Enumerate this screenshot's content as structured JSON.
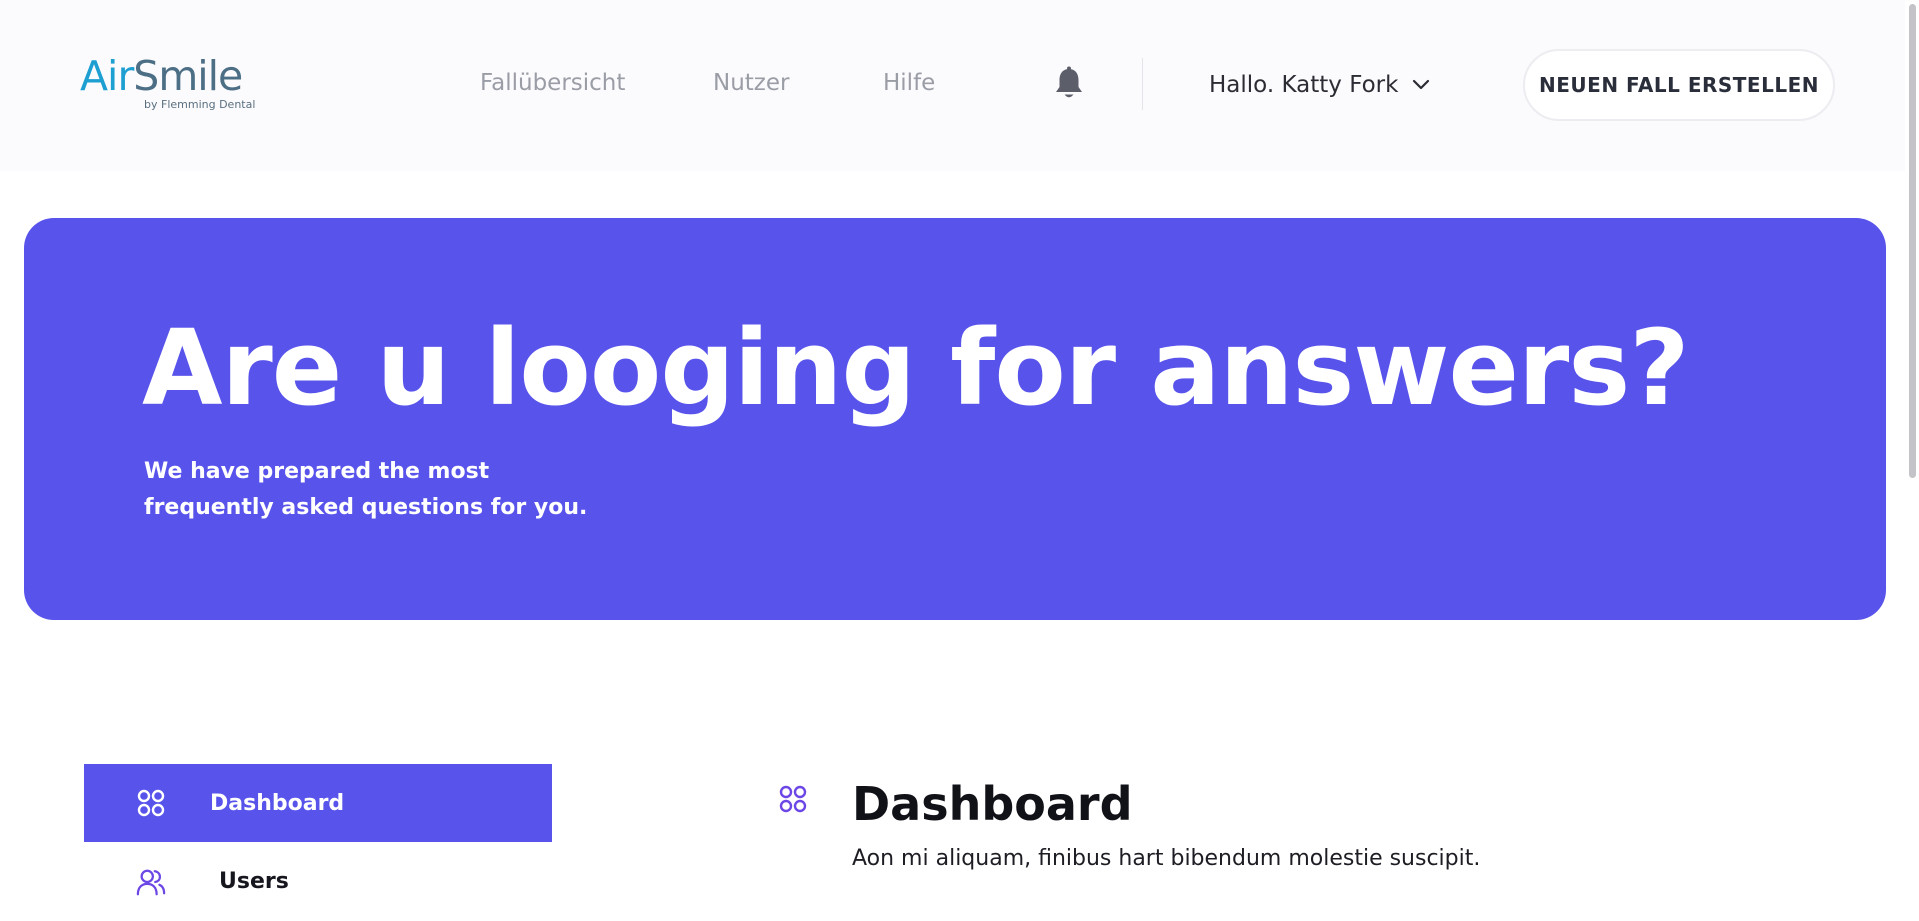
{
  "header": {
    "logo": {
      "part1": "Air",
      "part2": "Smile",
      "tagline": "by Flemming Dental"
    },
    "nav": [
      {
        "label": "Fallübersicht"
      },
      {
        "label": "Nutzer"
      },
      {
        "label": "Hilfe"
      }
    ],
    "notifications_icon": "bell-icon",
    "user_greeting": "Hallo. Katty Fork",
    "cta_label": "NEUEN FALL ERSTELLEN"
  },
  "hero": {
    "title": "Are u looging for answers?",
    "subtitle": "We have prepared the most frequently asked questions for you."
  },
  "sidebar": {
    "items": [
      {
        "label": "Dashboard",
        "icon": "dashboard-icon",
        "active": true
      },
      {
        "label": "Users",
        "icon": "users-icon",
        "active": false
      }
    ]
  },
  "main": {
    "section_icon": "dashboard-icon",
    "title": "Dashboard",
    "description": "Aon mi aliquam, finibus hart bibendum molestie suscipit."
  },
  "colors": {
    "accent": "#5853eb",
    "header_bg": "#fbfbfd",
    "logo_blue": "#1e9fd2",
    "logo_slate": "#4c6f86",
    "icon_purple": "#6c47e6"
  }
}
